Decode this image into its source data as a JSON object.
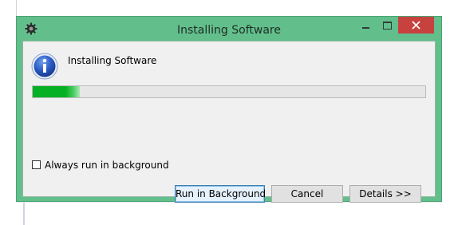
{
  "window": {
    "title": "Installing Software",
    "accent_color": "#62bf8c",
    "close_color": "#c7413f",
    "app_icon": "gear-icon",
    "controls": [
      "minimize-icon",
      "maximize-icon",
      "close-icon"
    ]
  },
  "dialog": {
    "icon": "info-icon",
    "message": "Installing Software",
    "progress_percent": 12,
    "progress_color": "#06b025",
    "checkbox": {
      "label": "Always run in background",
      "checked": false
    },
    "buttons": {
      "run_background": "Run in Background",
      "cancel": "Cancel",
      "details": "Details >>"
    }
  }
}
